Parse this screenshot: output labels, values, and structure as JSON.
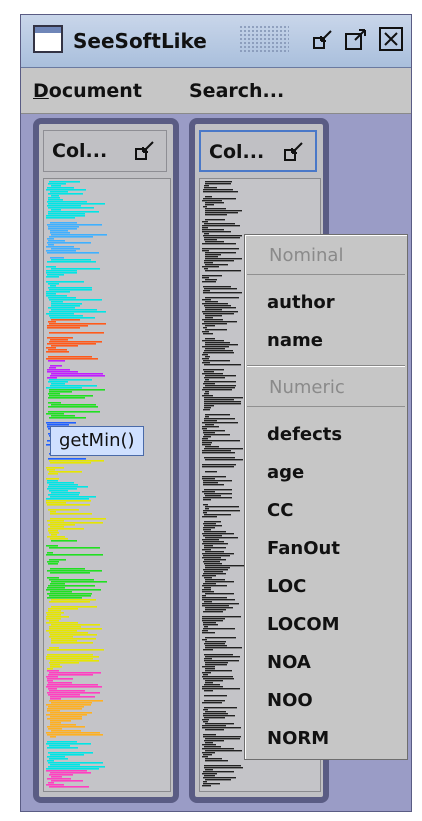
{
  "window": {
    "title": "SeeSoftLike"
  },
  "menubar": {
    "document": "Document",
    "document_rest": "ocument",
    "document_mnemonic": "D",
    "search": "Search..."
  },
  "columns": [
    {
      "title": "Col..."
    },
    {
      "title": "Col..."
    }
  ],
  "tooltip": {
    "text": "getMin()"
  },
  "popup": {
    "nominal_header": "Nominal",
    "nominal_items": [
      "author",
      "name"
    ],
    "numeric_header": "Numeric",
    "numeric_items": [
      "defects",
      "age",
      "CC",
      "FanOut",
      "LOC",
      "LOCOM",
      "NOA",
      "NOO",
      "NORM"
    ]
  },
  "colors": {
    "window_border": "#5a5c84",
    "title_gradient_top": "#c9d6ea",
    "tooltip_bg": "#cfe0ff",
    "code_palette": [
      "#00e5e5",
      "#3fb0ff",
      "#ff5a1a",
      "#c020ff",
      "#20e020",
      "#e6e600",
      "#ff40c0",
      "#2060ff",
      "#ffb020"
    ]
  }
}
